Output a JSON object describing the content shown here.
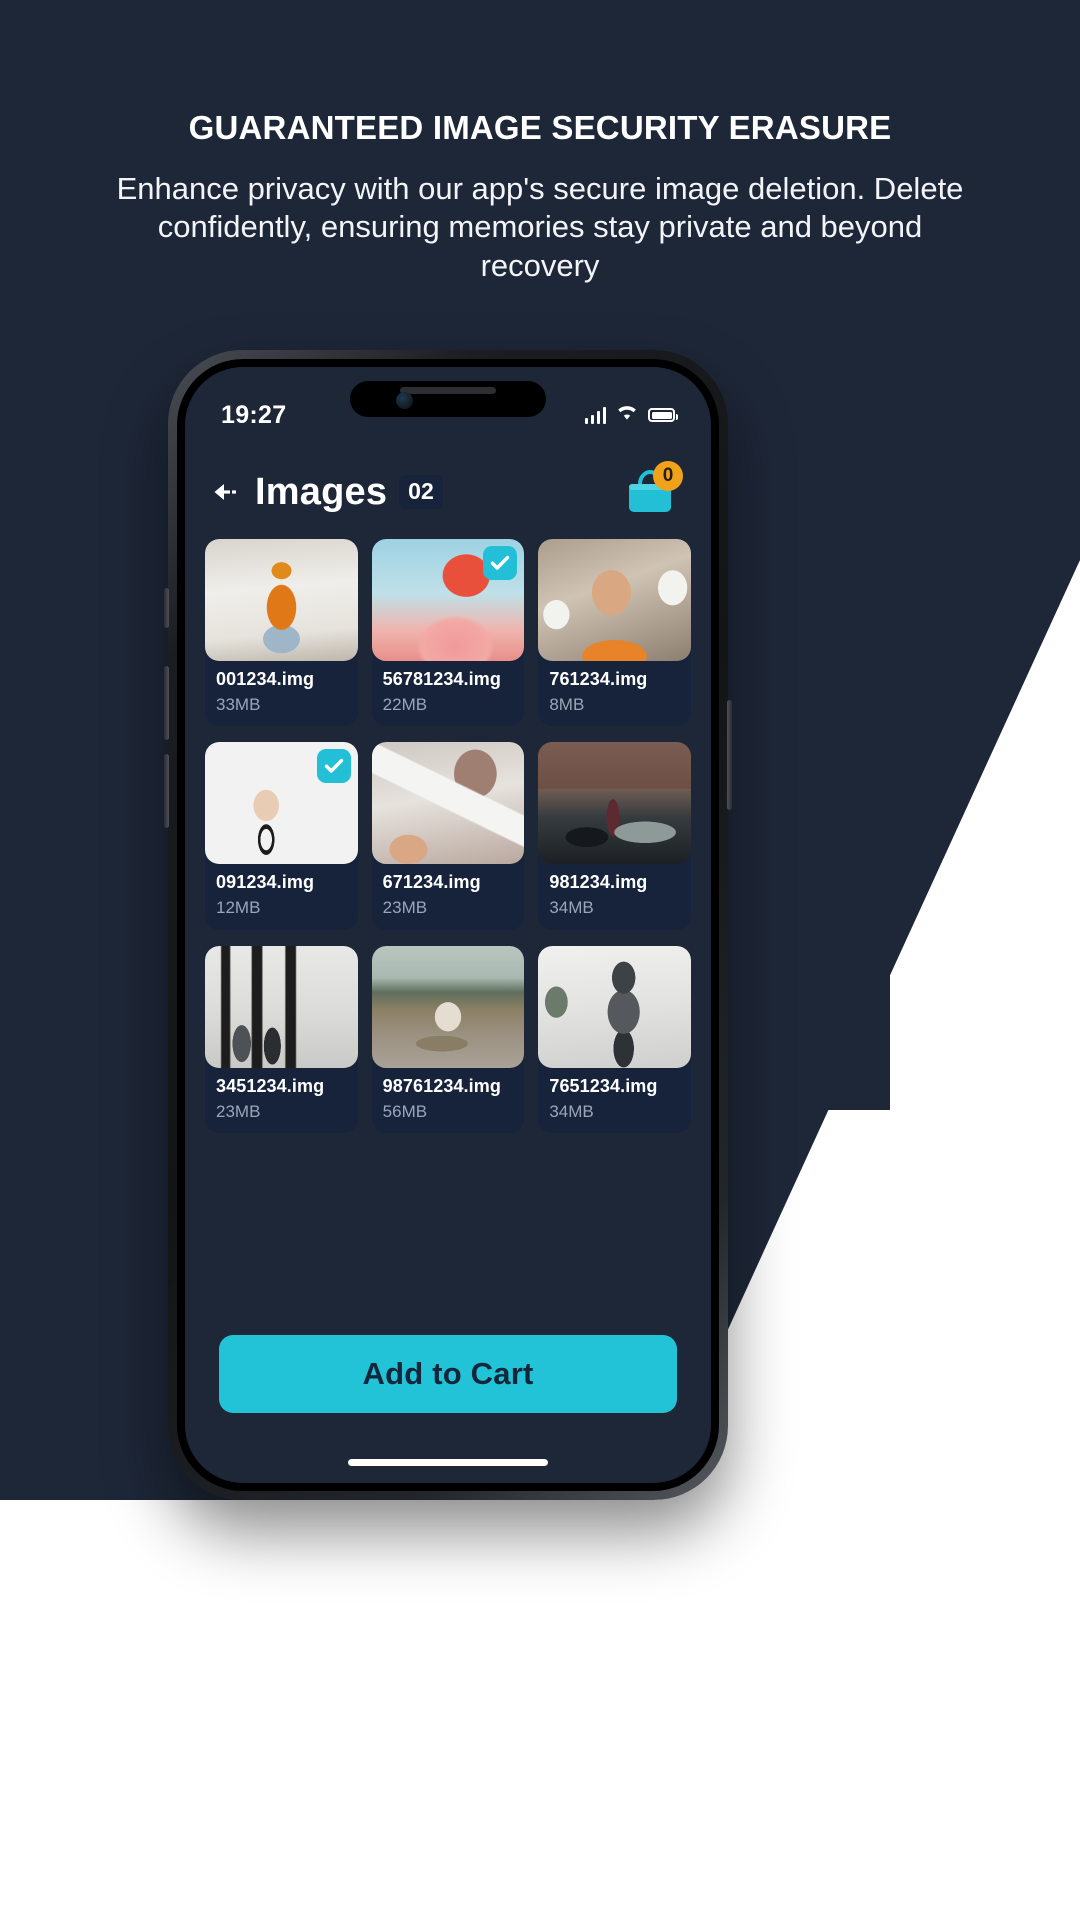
{
  "promo": {
    "headline": "GUARANTEED IMAGE SECURITY ERASURE",
    "subheadline": "Enhance privacy with our app's secure image deletion. Delete confidently, ensuring memories stay private and beyond recovery",
    "background_color": "#1e2738",
    "accent_color": "#22c3d6"
  },
  "status_bar": {
    "clock": "19:27",
    "signal_icon": "cellular-bars-icon",
    "wifi_icon": "wifi-icon",
    "battery_icon": "battery-full-icon"
  },
  "app_header": {
    "back_icon": "back-arrow-icon",
    "title": "Images",
    "selected_count": "02",
    "cart_icon": "shopping-bag-icon",
    "cart_count": "0",
    "cart_badge_color": "#f0a31a",
    "cart_icon_color": "#22bfd6"
  },
  "grid": {
    "items": [
      {
        "filename": "001234.img",
        "size": "33MB",
        "selected": false,
        "art": "art-snow",
        "art_name": "woman-in-snow-photo"
      },
      {
        "filename": "56781234.img",
        "size": "22MB",
        "selected": true,
        "art": "art-flamingo",
        "art_name": "flamingo-photo"
      },
      {
        "filename": "761234.img",
        "size": "8MB",
        "selected": false,
        "art": "art-dentist",
        "art_name": "child-dentist-photo"
      },
      {
        "filename": "091234.img",
        "size": "12MB",
        "selected": true,
        "art": "art-cinema",
        "art_name": "cinema-audience-photo"
      },
      {
        "filename": "671234.img",
        "size": "23MB",
        "selected": false,
        "art": "art-polaroid",
        "art_name": "polaroid-prints-photo"
      },
      {
        "filename": "981234.img",
        "size": "34MB",
        "selected": false,
        "art": "art-car",
        "art_name": "graduate-with-car-photo"
      },
      {
        "filename": "3451234.img",
        "size": "23MB",
        "selected": false,
        "art": "art-gallery",
        "art_name": "art-gallery-photo"
      },
      {
        "filename": "98761234.img",
        "size": "56MB",
        "selected": false,
        "art": "art-road",
        "art_name": "man-on-road-photo"
      },
      {
        "filename": "7651234.img",
        "size": "34MB",
        "selected": false,
        "art": "art-fashion",
        "art_name": "fashion-portrait-photo"
      }
    ],
    "selection_check_icon": "check-icon",
    "selection_check_color": "#22bfd6"
  },
  "cta": {
    "label": "Add to Cart",
    "background_color": "#22c3d6",
    "text_color": "#14263b"
  }
}
